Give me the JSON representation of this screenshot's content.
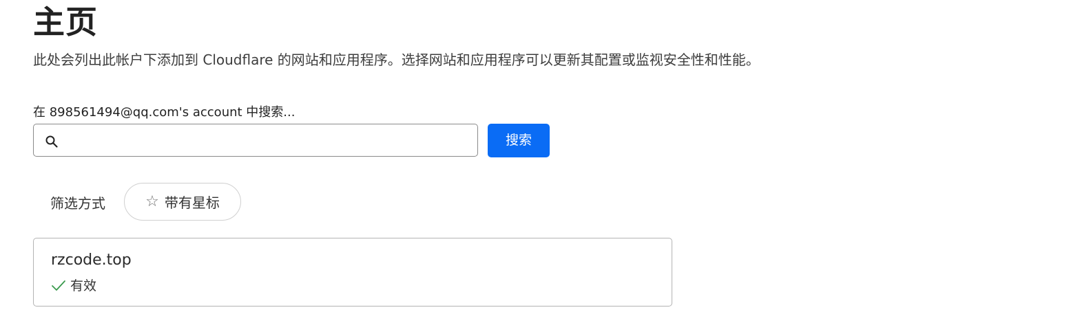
{
  "page": {
    "title": "主页",
    "description": "此处会列出此帐户下添加到 Cloudflare 的网站和应用程序。选择网站和应用程序可以更新其配置或监视安全性和性能。"
  },
  "search": {
    "label": "在 898561494@qq.com's account 中搜索...",
    "value": "",
    "placeholder": "",
    "icon": "search-icon",
    "button_label": "搜索"
  },
  "filter": {
    "label": "筛选方式",
    "chips": [
      {
        "label": "带有星标",
        "icon": "star-outline-icon"
      }
    ]
  },
  "sites": [
    {
      "name": "rzcode.top",
      "status": "有效",
      "status_icon": "check-icon"
    }
  ],
  "colors": {
    "primary_button": "#0a6cf5",
    "status_ok": "#3a9a4d",
    "text": "#313131",
    "border": "#8a8a8a"
  }
}
